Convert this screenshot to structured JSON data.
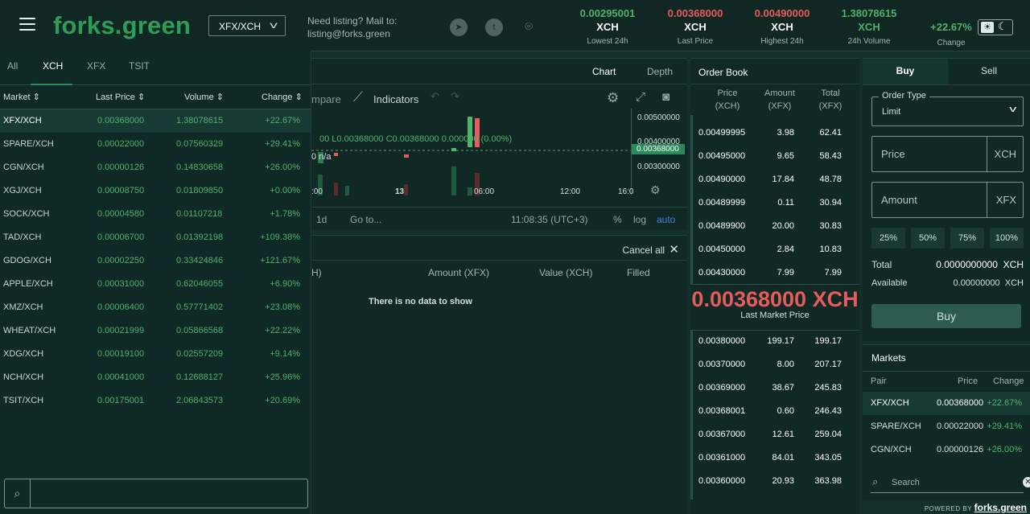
{
  "header": {
    "logo": "forks.green",
    "pair_select": "XFX/XCH",
    "listing_line1": "Need listing? Mail to:",
    "listing_line2": "listing@forks.green",
    "social": [
      "telegram-icon",
      "twitter-icon",
      "discord-icon"
    ],
    "stats": [
      {
        "value": "0.00295001",
        "unit": "XCH",
        "label": "Lowest 24h",
        "color": "#4fb36b"
      },
      {
        "value": "0.00368000",
        "unit": "XCH",
        "label": "Last Price",
        "color": "#e65c5c"
      },
      {
        "value": "0.00490000",
        "unit": "XCH",
        "label": "Highest 24h",
        "color": "#e65c5c"
      },
      {
        "value": "1.38078615",
        "unit": "XCH",
        "label": "24h Volume",
        "color": "#4fb36b"
      }
    ],
    "change_value": "+22.67%",
    "change_label": "Change"
  },
  "market_panel": {
    "tabs": [
      "All",
      "XCH",
      "XFX",
      "TSIT"
    ],
    "active_tab": "XCH",
    "columns": [
      "Market ⇕",
      "Last Price ⇕",
      "Volume ⇕",
      "Change ⇕"
    ],
    "rows": [
      {
        "pair": "XFX/XCH",
        "price": "0.00368000",
        "volume": "1.38078615",
        "change": "+22.67%"
      },
      {
        "pair": "SPARE/XCH",
        "price": "0.00022000",
        "volume": "0.07560329",
        "change": "+29.41%"
      },
      {
        "pair": "CGN/XCH",
        "price": "0.00000126",
        "volume": "0.14830658",
        "change": "+26.00%"
      },
      {
        "pair": "XGJ/XCH",
        "price": "0.00008750",
        "volume": "0.01809850",
        "change": "+0.00%"
      },
      {
        "pair": "SOCK/XCH",
        "price": "0.00004580",
        "volume": "0.01107218",
        "change": "+1.78%"
      },
      {
        "pair": "TAD/XCH",
        "price": "0.00006700",
        "volume": "0.01392198",
        "change": "+109.38%"
      },
      {
        "pair": "GDOG/XCH",
        "price": "0.00002250",
        "volume": "0.33424846",
        "change": "+121.67%"
      },
      {
        "pair": "APPLE/XCH",
        "price": "0.00031000",
        "volume": "0.62046055",
        "change": "+6.90%"
      },
      {
        "pair": "XMZ/XCH",
        "price": "0.00006400",
        "volume": "0.57771402",
        "change": "+23.08%"
      },
      {
        "pair": "WHEAT/XCH",
        "price": "0.00021999",
        "volume": "0.05866568",
        "change": "+22.22%"
      },
      {
        "pair": "XDG/XCH",
        "price": "0.00019100",
        "volume": "0.02557209",
        "change": "+9.14%"
      },
      {
        "pair": "NCH/XCH",
        "price": "0.00041000",
        "volume": "0.12688127",
        "change": "+25.96%"
      },
      {
        "pair": "TSIT/XCH",
        "price": "0.00175001",
        "volume": "2.06843573",
        "change": "+20.69%"
      }
    ],
    "search_value": ""
  },
  "chart": {
    "tabs": [
      "Chart",
      "Depth"
    ],
    "active_tab": "Chart",
    "toolbar_compare": "mpare",
    "toolbar_indicators": "Indicators",
    "ohlc_text": "00 L0.00368000 C0.00368000 0.000000 (0.00%)",
    "na_text": "0 n/a",
    "y_labels": [
      "0.00500000",
      "0.00400000",
      "0.00300000"
    ],
    "current_price": "0.00368000",
    "x_labels": [
      ":00",
      "13",
      "06:00",
      "12:00",
      "16:0"
    ],
    "range": "1d",
    "goto": "Go to...",
    "time": "11:08:35 (UTC+3)",
    "pct": "%",
    "log": "log",
    "auto": "auto",
    "accent": "#3f82d8"
  },
  "orders": {
    "cancel_all": "Cancel all",
    "columns": [
      "H)",
      "Amount (XFX)",
      "Value (XCH)",
      "Filled"
    ],
    "empty": "There is no data to show"
  },
  "order_book": {
    "title": "Order Book",
    "col_price": [
      "Price",
      "(XCH)"
    ],
    "col_amount": [
      "Amount",
      "(XFX)"
    ],
    "col_total": [
      "Total",
      "(XFX)"
    ],
    "asks": [
      {
        "p1": "0.004",
        "p2": "99995",
        "amount": "3.98",
        "total": "62.41"
      },
      {
        "p1": "0.004",
        "p2": "95000",
        "amount": "9.65",
        "total": "58.43"
      },
      {
        "p1": "0.004",
        "p2": "90000",
        "amount": "17.84",
        "total": "48.78"
      },
      {
        "p1": "0.004",
        "p2": "89999",
        "amount": "0.11",
        "total": "30.94"
      },
      {
        "p1": "0.004",
        "p2": "89900",
        "amount": "20.00",
        "total": "30.83"
      },
      {
        "p1": "0.004",
        "p2": "50000",
        "amount": "2.84",
        "total": "10.83"
      },
      {
        "p1": "0.004",
        "p2": "30000",
        "amount": "7.99",
        "total": "7.99"
      }
    ],
    "last_price": "0.00368000 XCH",
    "last_price_label": "Last Market Price",
    "bids": [
      {
        "p1": "0.003",
        "p2": "80000",
        "amount": "199.17",
        "total": "199.17"
      },
      {
        "p1": "0.003",
        "p2": "70000",
        "amount": "8.00",
        "total": "207.17"
      },
      {
        "p1": "0.003",
        "p2": "69000",
        "amount": "38.67",
        "total": "245.83"
      },
      {
        "p1": "0.003",
        "p2": "68001",
        "amount": "0.60",
        "total": "246.43"
      },
      {
        "p1": "0.003",
        "p2": "67000",
        "amount": "12.61",
        "total": "259.04"
      },
      {
        "p1": "0.003",
        "p2": "61000",
        "amount": "84.01",
        "total": "343.05"
      },
      {
        "p1": "0.003",
        "p2": "60000",
        "amount": "20.93",
        "total": "363.98"
      }
    ]
  },
  "trade": {
    "tab_buy": "Buy",
    "tab_sell": "Sell",
    "order_type_label": "Order Type",
    "order_type_value": "Limit",
    "price_placeholder": "Price",
    "price_unit": "XCH",
    "amount_placeholder": "Amount",
    "amount_unit": "XFX",
    "percents": [
      "25%",
      "50%",
      "75%",
      "100%"
    ],
    "total_label": "Total",
    "total_value": "0.0000000000",
    "total_unit": "XCH",
    "available_label": "Available",
    "available_value": "0.00000000",
    "available_unit": "XCH",
    "buy_button": "Buy"
  },
  "mini_markets": {
    "title": "Markets",
    "columns": [
      "Pair",
      "Price",
      "Change"
    ],
    "rows": [
      {
        "pair": "XFX/XCH",
        "price": "0.00368000",
        "change": "+22.67%"
      },
      {
        "pair": "SPARE/XCH",
        "price": "0.00022000",
        "change": "+29.41%"
      },
      {
        "pair": "CGN/XCH",
        "price": "0.00000126",
        "change": "+26.00%"
      }
    ],
    "search_placeholder": "Search"
  },
  "footer": {
    "powered": "POWERED BY",
    "brand": "forks.green"
  }
}
